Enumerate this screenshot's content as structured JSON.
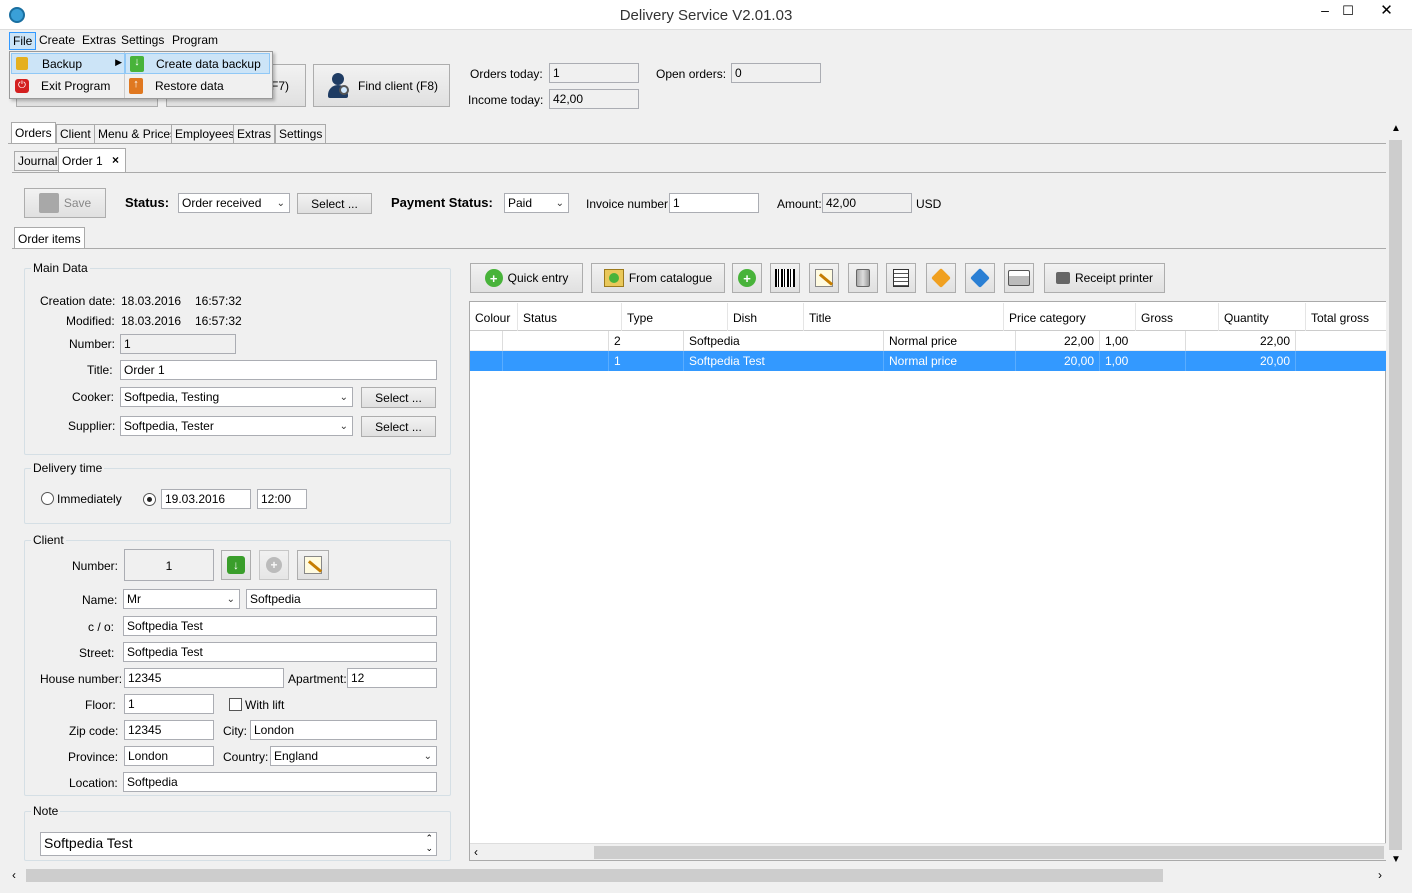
{
  "window": {
    "title": "Delivery Service V2.01.03"
  },
  "menubar": [
    "File",
    "Create",
    "Extras",
    "Settings",
    "Program"
  ],
  "file_menu": {
    "backup": "Backup",
    "exit": "Exit Program"
  },
  "backup_submenu": {
    "create": "Create data backup",
    "restore": "Restore data"
  },
  "toolbar": {
    "btn2_label_partial": "F7)",
    "find_client": "Find client (F8)"
  },
  "stats": {
    "orders_today_label": "Orders today:",
    "orders_today": "1",
    "income_today_label": "Income today:",
    "income_today": "42,00",
    "open_orders_label": "Open orders:",
    "open_orders": "0"
  },
  "main_tabs": [
    "Orders",
    "Client",
    "Menu & Prices",
    "Employees",
    "Extras",
    "Settings"
  ],
  "sub_tabs": {
    "journal": "Journal",
    "order": "Order 1",
    "close": "×"
  },
  "order_bar": {
    "save": "Save",
    "status_label": "Status:",
    "status_value": "Order received",
    "select": "Select ...",
    "payment_label": "Payment Status:",
    "payment_value": "Paid",
    "invoice_label": "Invoice number:",
    "invoice_value": "1",
    "amount_label": "Amount:",
    "amount_value": "42,00",
    "currency": "USD"
  },
  "order_items_tab": "Order items",
  "main_data": {
    "title": "Main Data",
    "creation_label": "Creation date:",
    "creation_date": "18.03.2016",
    "creation_time": "16:57:32",
    "modified_label": "Modified:",
    "modified_date": "18.03.2016",
    "modified_time": "16:57:32",
    "number_label": "Number:",
    "number": "1",
    "title_label": "Title:",
    "title_value": "Order 1",
    "cooker_label": "Cooker:",
    "cooker": "Softpedia, Testing",
    "supplier_label": "Supplier:",
    "supplier": "Softpedia, Tester",
    "select": "Select ..."
  },
  "delivery": {
    "title": "Delivery time",
    "immediately": "Immediately",
    "date": "19.03.2016",
    "time": "12:00"
  },
  "client": {
    "title": "Client",
    "number_label": "Number:",
    "number": "1",
    "name_label": "Name:",
    "salutation": "Mr",
    "name": "Softpedia",
    "co_label": "c / o:",
    "co": "Softpedia Test",
    "street_label": "Street:",
    "street": "Softpedia Test",
    "house_label": "House number:",
    "house": "12345",
    "apartment_label": "Apartment:",
    "apartment": "12",
    "floor_label": "Floor:",
    "floor": "1",
    "lift_label": "With lift",
    "zip_label": "Zip code:",
    "zip": "12345",
    "city_label": "City:",
    "city": "London",
    "province_label": "Province:",
    "province": "London",
    "country_label": "Country:",
    "country": "England",
    "location_label": "Location:",
    "location": "Softpedia"
  },
  "note": {
    "title": "Note",
    "value": "Softpedia Test"
  },
  "items_toolbar": {
    "quick_entry": "Quick entry",
    "from_catalogue": "From catalogue",
    "receipt_printer": "Receipt printer"
  },
  "table": {
    "columns": [
      "Colour",
      "Status",
      "Type",
      "Dish",
      "Title",
      "Price category",
      "Gross",
      "Quantity",
      "Total gross"
    ],
    "rows": [
      {
        "type": "2",
        "title": "Softpedia",
        "price_category": "Normal price",
        "gross": "22,00",
        "quantity": "1,00",
        "total": "22,00"
      },
      {
        "type": "1",
        "title": "Softpedia Test",
        "price_category": "Normal price",
        "gross": "20,00",
        "quantity": "1,00",
        "total": "20,00"
      }
    ]
  },
  "colors": {
    "accent": "#3399ff",
    "selected_row": "#3399ff",
    "title_bar": "#ffffff"
  }
}
